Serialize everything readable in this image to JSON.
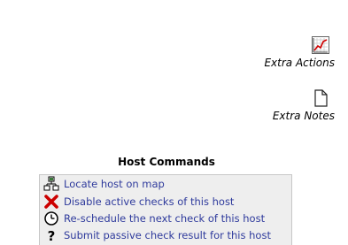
{
  "extra": {
    "actions_label": "Extra Actions",
    "actions_icon": "chart-icon",
    "notes_label": "Extra Notes",
    "notes_icon": "document-icon"
  },
  "host_commands": {
    "title": "Host Commands",
    "items": [
      {
        "label": "Locate host on map",
        "icon": "network-map-icon"
      },
      {
        "label": "Disable active checks of this host",
        "icon": "red-x-icon"
      },
      {
        "label": "Re-schedule the next check of this host",
        "icon": "clock-icon"
      },
      {
        "label": "Submit passive check result for this host",
        "icon": "question-mark-icon"
      }
    ]
  },
  "colors": {
    "link": "#2e3a9c",
    "box_background": "#eeeeee",
    "box_border": "#c7c7c7",
    "disable_icon": "#cc0000"
  }
}
